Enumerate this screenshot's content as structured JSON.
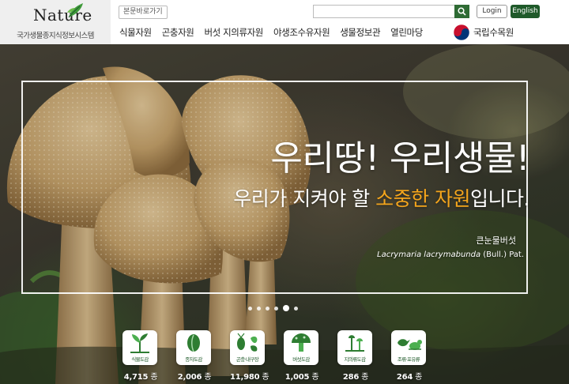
{
  "header": {
    "logo_word": "Nature",
    "logo_subtitle": "국가생물종지식정보시스템",
    "skip_label": "본문바로가기",
    "search": {
      "placeholder": "",
      "value": ""
    },
    "login_label": "Login",
    "english_label": "English",
    "nav": [
      "식물자원",
      "곤충자원",
      "버섯 지의류자원",
      "야생조수유자원",
      "생물정보관",
      "열린마당"
    ],
    "gov_label": "국립수목원"
  },
  "hero": {
    "headline": "우리땅! 우리생물!",
    "subline_pre": "우리가 지켜야 할 ",
    "subline_accent": "소중한 자원",
    "subline_post": "입니다.",
    "species_korean": "큰눈물버섯",
    "species_scientific": "Lacrymaria lacrymabunda",
    "species_author": " (Bull.) Pat.",
    "slides_total": 6,
    "slide_active": 5
  },
  "categories": [
    {
      "label": "식물도감",
      "count": "4,715",
      "unit": "종",
      "icon": "plant-sprout-icon"
    },
    {
      "label": "종자도감",
      "count": "2,006",
      "unit": "종",
      "icon": "seed-icon"
    },
    {
      "label": "곤충·내구장",
      "count": "11,980",
      "unit": "종",
      "icon": "insect-icon"
    },
    {
      "label": "버섯도감",
      "count": "1,005",
      "unit": "종",
      "icon": "mushroom-icon"
    },
    {
      "label": "지의류도감",
      "count": "286",
      "unit": "종",
      "icon": "lichen-icon"
    },
    {
      "label": "조류·포유류",
      "count": "264",
      "unit": "종",
      "icon": "bird-mammal-icon"
    }
  ],
  "colors": {
    "brand_green": "#1f5a2a",
    "accent_orange": "#f4a51c"
  }
}
